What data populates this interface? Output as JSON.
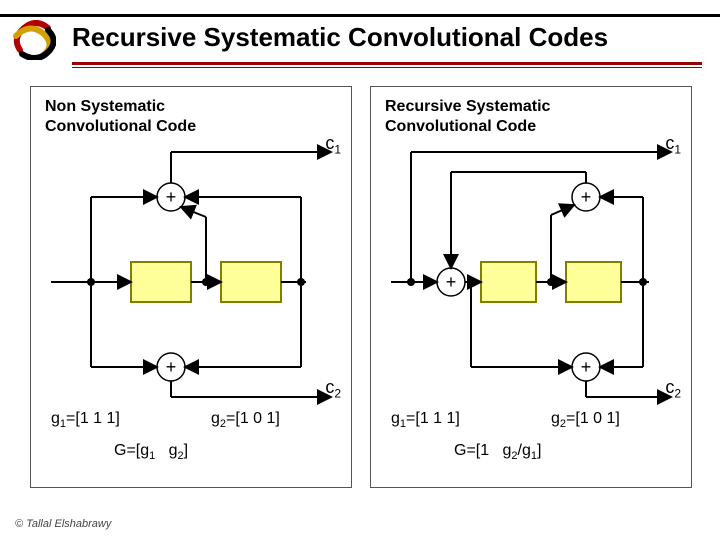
{
  "title": "Recursive Systematic Convolutional Codes",
  "left": {
    "heading": "Non Systematic\nConvolutional Code",
    "c1": "c",
    "c1sub": "1",
    "c2": "c",
    "c2sub": "2",
    "g1_lhs": "g",
    "g1_sub": "1",
    "g1_rhs": "=[1 1 1]",
    "g2_lhs": "g",
    "g2_sub": "2",
    "g2_rhs": "=[1 0 1]",
    "Gpre": "G=[g",
    "Gs1": "1",
    "Gmid": "   g",
    "Gs2": "2",
    "Gend": "]"
  },
  "right": {
    "heading": "Recursive Systematic\nConvolutional Code",
    "c1": "c",
    "c1sub": "1",
    "c2": "c",
    "c2sub": "2",
    "g1_lhs": "g",
    "g1_sub": "1",
    "g1_rhs": "=[1 1 1]",
    "g2_lhs": "g",
    "g2_sub": "2",
    "g2_rhs": "=[1 0 1]",
    "Gpre": "G=[1   g",
    "Gs2": "2",
    "Gmid": "/g",
    "Gs1": "1",
    "Gend": "]"
  },
  "footer": "© Tallal Elshabrawy"
}
